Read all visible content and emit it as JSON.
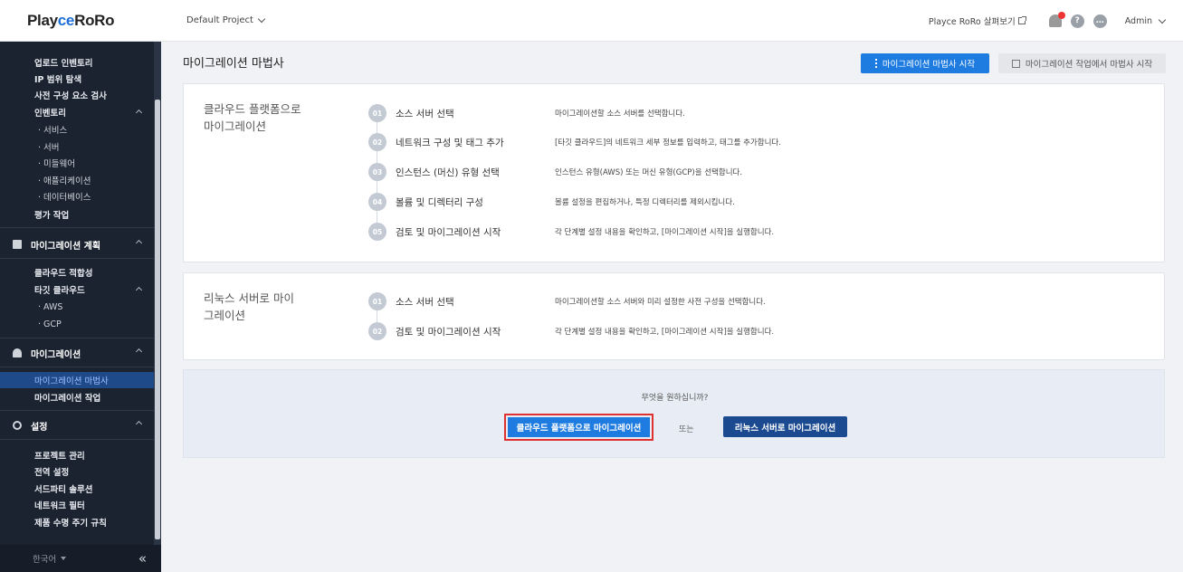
{
  "app": {
    "logo_prefix": "Playce",
    "logo_ce": "",
    "logo_full": "PlayceRoRo"
  },
  "topbar": {
    "project": "Default Project",
    "external_link": "Playce RoRo 살펴보기",
    "user": "Admin"
  },
  "sidebar": {
    "items": [
      {
        "label": "업로드 인벤토리"
      },
      {
        "label": "IP 범위 탐색"
      },
      {
        "label": "사전 구성 요소 검사"
      },
      {
        "label": "인벤토리"
      },
      {
        "label": "· 서비스"
      },
      {
        "label": "· 서버"
      },
      {
        "label": "· 미들웨어"
      },
      {
        "label": "· 애플리케이션"
      },
      {
        "label": "· 데이터베이스"
      },
      {
        "label": "평가 작업"
      },
      {
        "label": "마이그레이션 계획"
      },
      {
        "label": "클라우드 적합성"
      },
      {
        "label": "타깃 클라우드"
      },
      {
        "label": "· AWS"
      },
      {
        "label": "· GCP"
      },
      {
        "label": "마이그레이션"
      },
      {
        "label": "마이그레이션 마법사"
      },
      {
        "label": "마이그레이션 작업"
      },
      {
        "label": "설정"
      },
      {
        "label": "프로젝트 관리"
      },
      {
        "label": "전역 설정"
      },
      {
        "label": "서드파티 솔루션"
      },
      {
        "label": "네트워크 필터"
      },
      {
        "label": "제품 수명 주기 규칙"
      }
    ],
    "language": "한국어",
    "collapse": "«"
  },
  "main": {
    "title": "마이그레이션 마법사",
    "start_button": "마이그레이션 마법사 시작",
    "start_from_job_button": "마이그레이션 작업에서 마법사 시작",
    "cloud_card": {
      "title": "클라우드 플랫폼으로 마이그레이션",
      "steps": [
        {
          "num": "01",
          "name": "소스 서버 선택",
          "desc": "마이그레이션할 소스 서버를 선택합니다."
        },
        {
          "num": "02",
          "name": "네트워크 구성 및 태그 추가",
          "desc": "[타깃 클라우드]의 네트워크 세부 정보를 입력하고, 태그를 추가합니다."
        },
        {
          "num": "03",
          "name": "인스턴스 (머신) 유형 선택",
          "desc": "인스턴스 유형(AWS) 또는 머신 유형(GCP)을 선택합니다."
        },
        {
          "num": "04",
          "name": "볼륨 및 디렉터리 구성",
          "desc": "볼륨 설정을 편집하거나, 특정 디렉터리를 제외시킵니다."
        },
        {
          "num": "05",
          "name": "검토 및 마이그레이션 시작",
          "desc": "각 단계별 설정 내용을 확인하고, [마이그레이션 시작]을 실행합니다."
        }
      ]
    },
    "linux_card": {
      "title": "리눅스 서버로 마이그레이션",
      "steps": [
        {
          "num": "01",
          "name": "소스 서버 선택",
          "desc": "마이그레이션할 소스 서버와 미리 설정한 사전 구성을 선택합니다."
        },
        {
          "num": "02",
          "name": "검토 및 마이그레이션 시작",
          "desc": "각 단계별 설정 내용을 확인하고, [마이그레이션 시작]을 실행합니다."
        }
      ]
    },
    "action": {
      "question": "무엇을 원하십니까?",
      "cloud_button": "클라우드 플랫폼으로 마이그레이션",
      "or": "또는",
      "linux_button": "리눅스 서버로 마이그레이션"
    }
  }
}
